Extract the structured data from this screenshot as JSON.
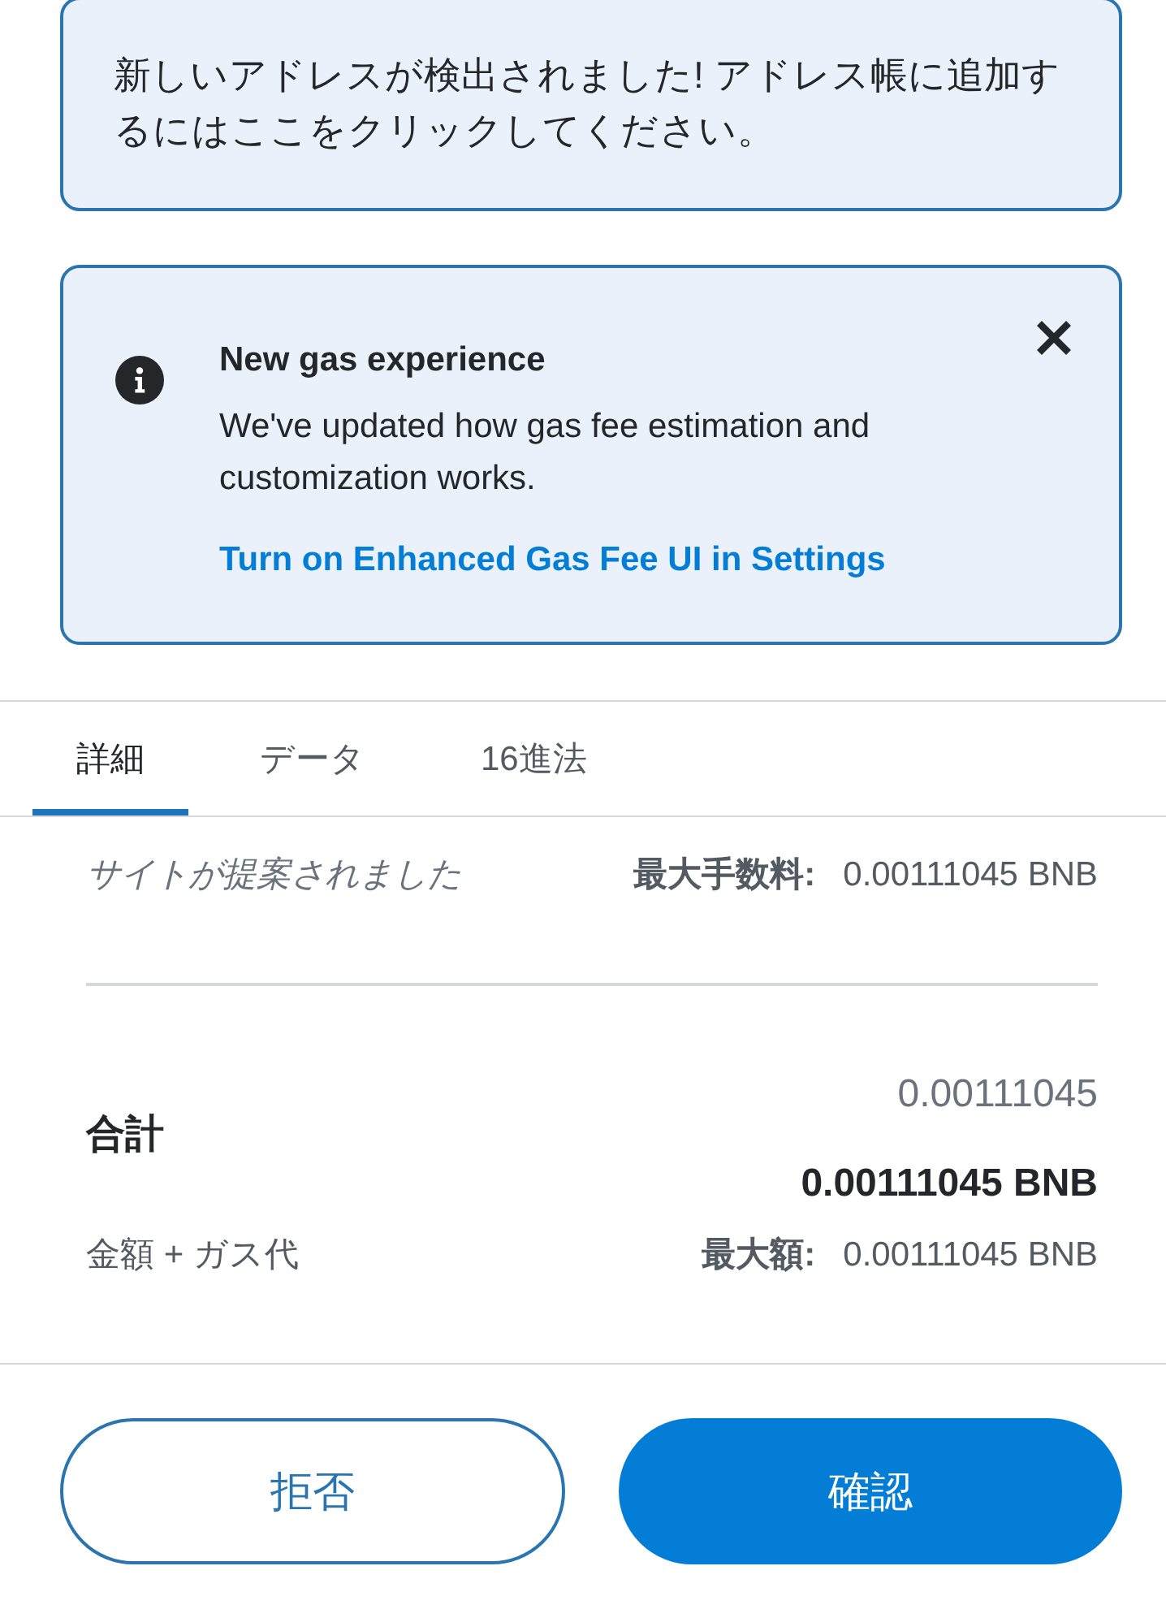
{
  "address_notice": {
    "text": "新しいアドレスが検出されました! アドレス帳に追加するにはここをクリックしてください。"
  },
  "gas_notice": {
    "title": "New gas experience",
    "body": "We've updated how gas fee estimation and customization works.",
    "link": "Turn on Enhanced Gas Fee UI in Settings"
  },
  "tabs": [
    {
      "label": "詳細",
      "selected": true
    },
    {
      "label": "データ",
      "selected": false
    },
    {
      "label": "16進法",
      "selected": false
    }
  ],
  "gas_fee": {
    "source": "サイトが提案されました",
    "label": "最大手数料:",
    "value": "0.00111045 BNB"
  },
  "total": {
    "label": "合計",
    "amount": "0.00111045",
    "amount_with_unit": "0.00111045 BNB",
    "sublabel": "金額 + ガス代",
    "max_label": "最大額:",
    "max_value": "0.00111045 BNB"
  },
  "buttons": [
    {
      "label": "拒否",
      "kind": "secondary"
    },
    {
      "label": "確認",
      "kind": "primary"
    }
  ]
}
